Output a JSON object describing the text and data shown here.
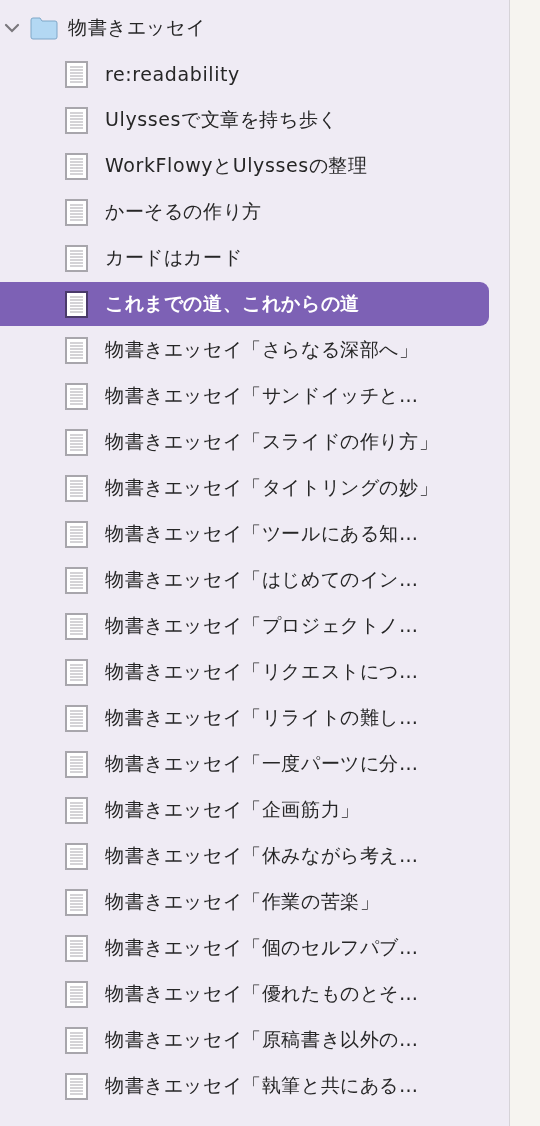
{
  "sidebar": {
    "folder": {
      "label": "物書きエッセイ",
      "expanded": true,
      "children": [
        {
          "label": "re:readability",
          "selected": false
        },
        {
          "label": "Ulyssesで文章を持ち歩く",
          "selected": false
        },
        {
          "label": "WorkFlowyとUlyssesの整理",
          "selected": false
        },
        {
          "label": "かーそるの作り方",
          "selected": false
        },
        {
          "label": "カードはカード",
          "selected": false
        },
        {
          "label": "これまでの道、これからの道",
          "selected": true
        },
        {
          "label": "物書きエッセイ「さらなる深部へ」",
          "selected": false
        },
        {
          "label": "物書きエッセイ「サンドイッチと…",
          "selected": false
        },
        {
          "label": "物書きエッセイ「スライドの作り方」",
          "selected": false
        },
        {
          "label": "物書きエッセイ「タイトリングの妙」",
          "selected": false
        },
        {
          "label": "物書きエッセイ「ツールにある知…",
          "selected": false
        },
        {
          "label": "物書きエッセイ「はじめてのイン…",
          "selected": false
        },
        {
          "label": "物書きエッセイ「プロジェクトノ…",
          "selected": false
        },
        {
          "label": "物書きエッセイ「リクエストにつ…",
          "selected": false
        },
        {
          "label": "物書きエッセイ「リライトの難し…",
          "selected": false
        },
        {
          "label": "物書きエッセイ「一度パーツに分…",
          "selected": false
        },
        {
          "label": "物書きエッセイ「企画筋力」",
          "selected": false
        },
        {
          "label": "物書きエッセイ「休みながら考え…",
          "selected": false
        },
        {
          "label": "物書きエッセイ「作業の苦楽」",
          "selected": false
        },
        {
          "label": "物書きエッセイ「個のセルフパブ…",
          "selected": false
        },
        {
          "label": "物書きエッセイ「優れたものとそ…",
          "selected": false
        },
        {
          "label": "物書きエッセイ「原稿書き以外の…",
          "selected": false
        },
        {
          "label": "物書きエッセイ「執筆と共にある…",
          "selected": false
        }
      ]
    }
  }
}
